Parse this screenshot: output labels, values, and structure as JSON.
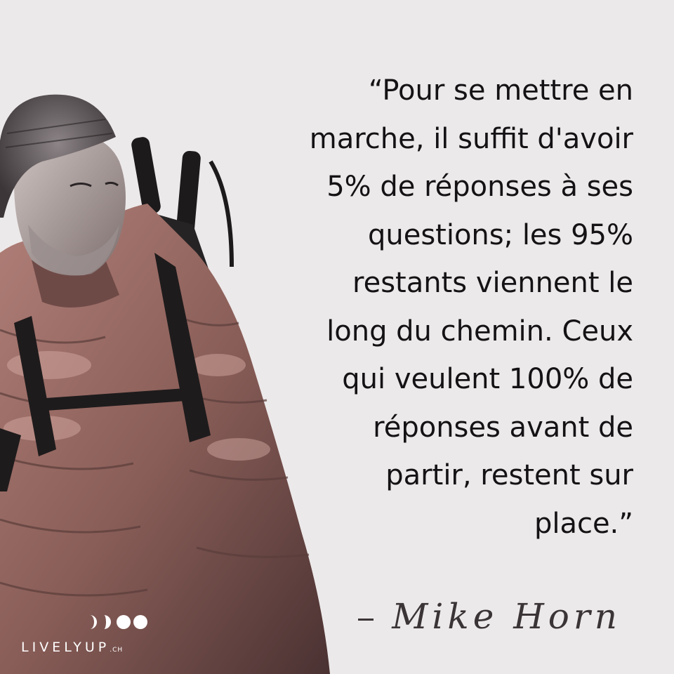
{
  "quote": {
    "lines": [
      "“Pour se mettre en",
      "marche, il suffit d'avoir",
      "5% de réponses à ses",
      "questions; les 95%",
      "restants viennent le",
      "long du chemin. Ceux",
      "qui veulent 100% de",
      "réponses avant de",
      "partir, restent sur",
      "place.”"
    ]
  },
  "attribution": {
    "dash": "–",
    "author": "Mike Horn"
  },
  "logo": {
    "brand": "LIVELYUP",
    "tld": ".CH"
  },
  "colors": {
    "background": "#ece9ea",
    "text": "#141214",
    "jacket": "#8a5e58"
  }
}
